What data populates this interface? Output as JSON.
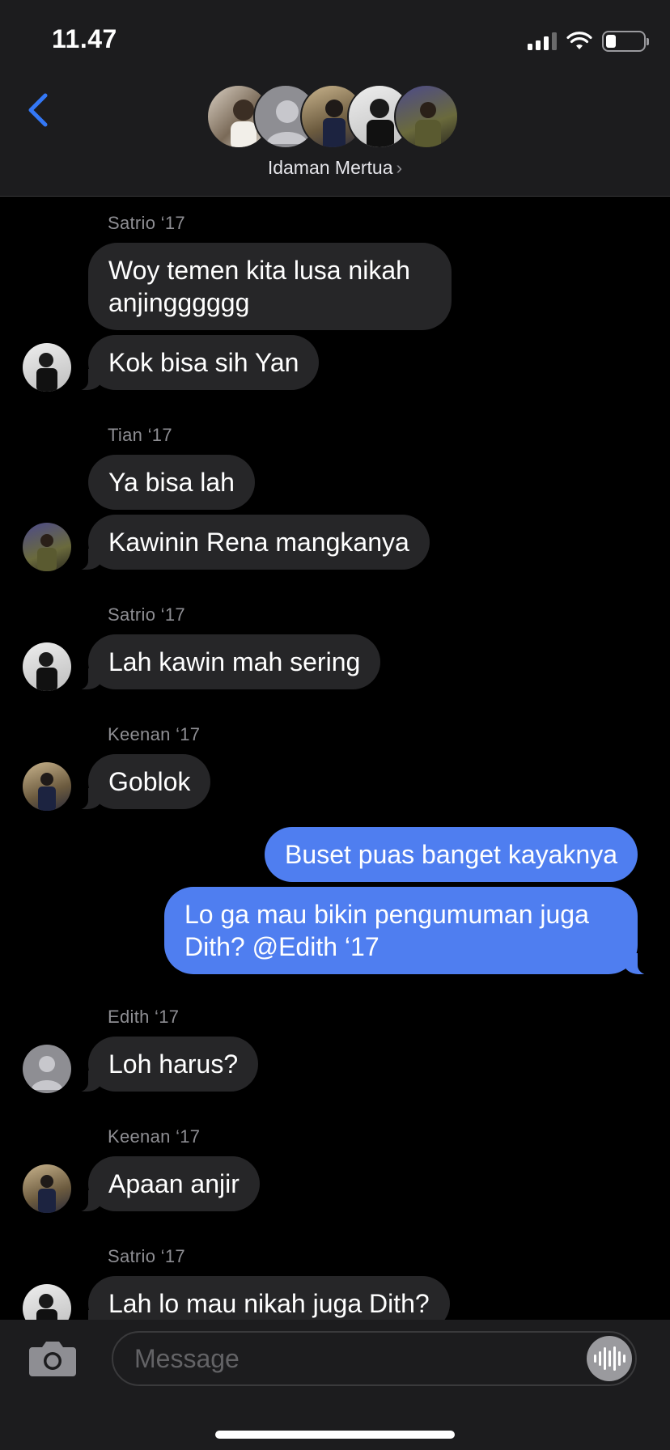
{
  "status_bar": {
    "time": "11.47"
  },
  "header": {
    "group_name": "Idaman Mertua",
    "chevron": "›"
  },
  "messages": [
    {
      "sender": "Satrio ‘17",
      "bubbles": [
        "Woy temen kita lusa nikah anjingggggg",
        "Kok bisa sih Yan"
      ]
    },
    {
      "sender": "Tian ‘17",
      "bubbles": [
        "Ya bisa lah",
        "Kawinin Rena mangkanya"
      ]
    },
    {
      "sender": "Satrio ‘17",
      "bubbles": [
        "Lah kawin mah sering"
      ]
    },
    {
      "sender": "Keenan ‘17",
      "bubbles": [
        "Goblok"
      ]
    },
    {
      "sender": "",
      "outgoing": true,
      "bubbles": [
        "Buset puas banget kayaknya",
        "Lo ga mau bikin pengumuman juga Dith? @Edith ‘17"
      ]
    },
    {
      "sender": "Edith ‘17",
      "bubbles": [
        "Loh harus?"
      ]
    },
    {
      "sender": "Keenan ‘17",
      "bubbles": [
        "Apaan anjir"
      ]
    },
    {
      "sender": "Satrio ‘17",
      "bubbles": [
        "Lah lo mau nikah juga Dith?"
      ]
    }
  ],
  "composer": {
    "placeholder": "Message"
  },
  "colors": {
    "outgoing": "#4f7ef0",
    "incoming": "#262628",
    "accent": "#3478f6"
  },
  "icons": [
    "back-chevron-icon",
    "signal-icon",
    "wifi-icon",
    "battery-icon",
    "camera-icon",
    "audio-waveform-icon"
  ]
}
